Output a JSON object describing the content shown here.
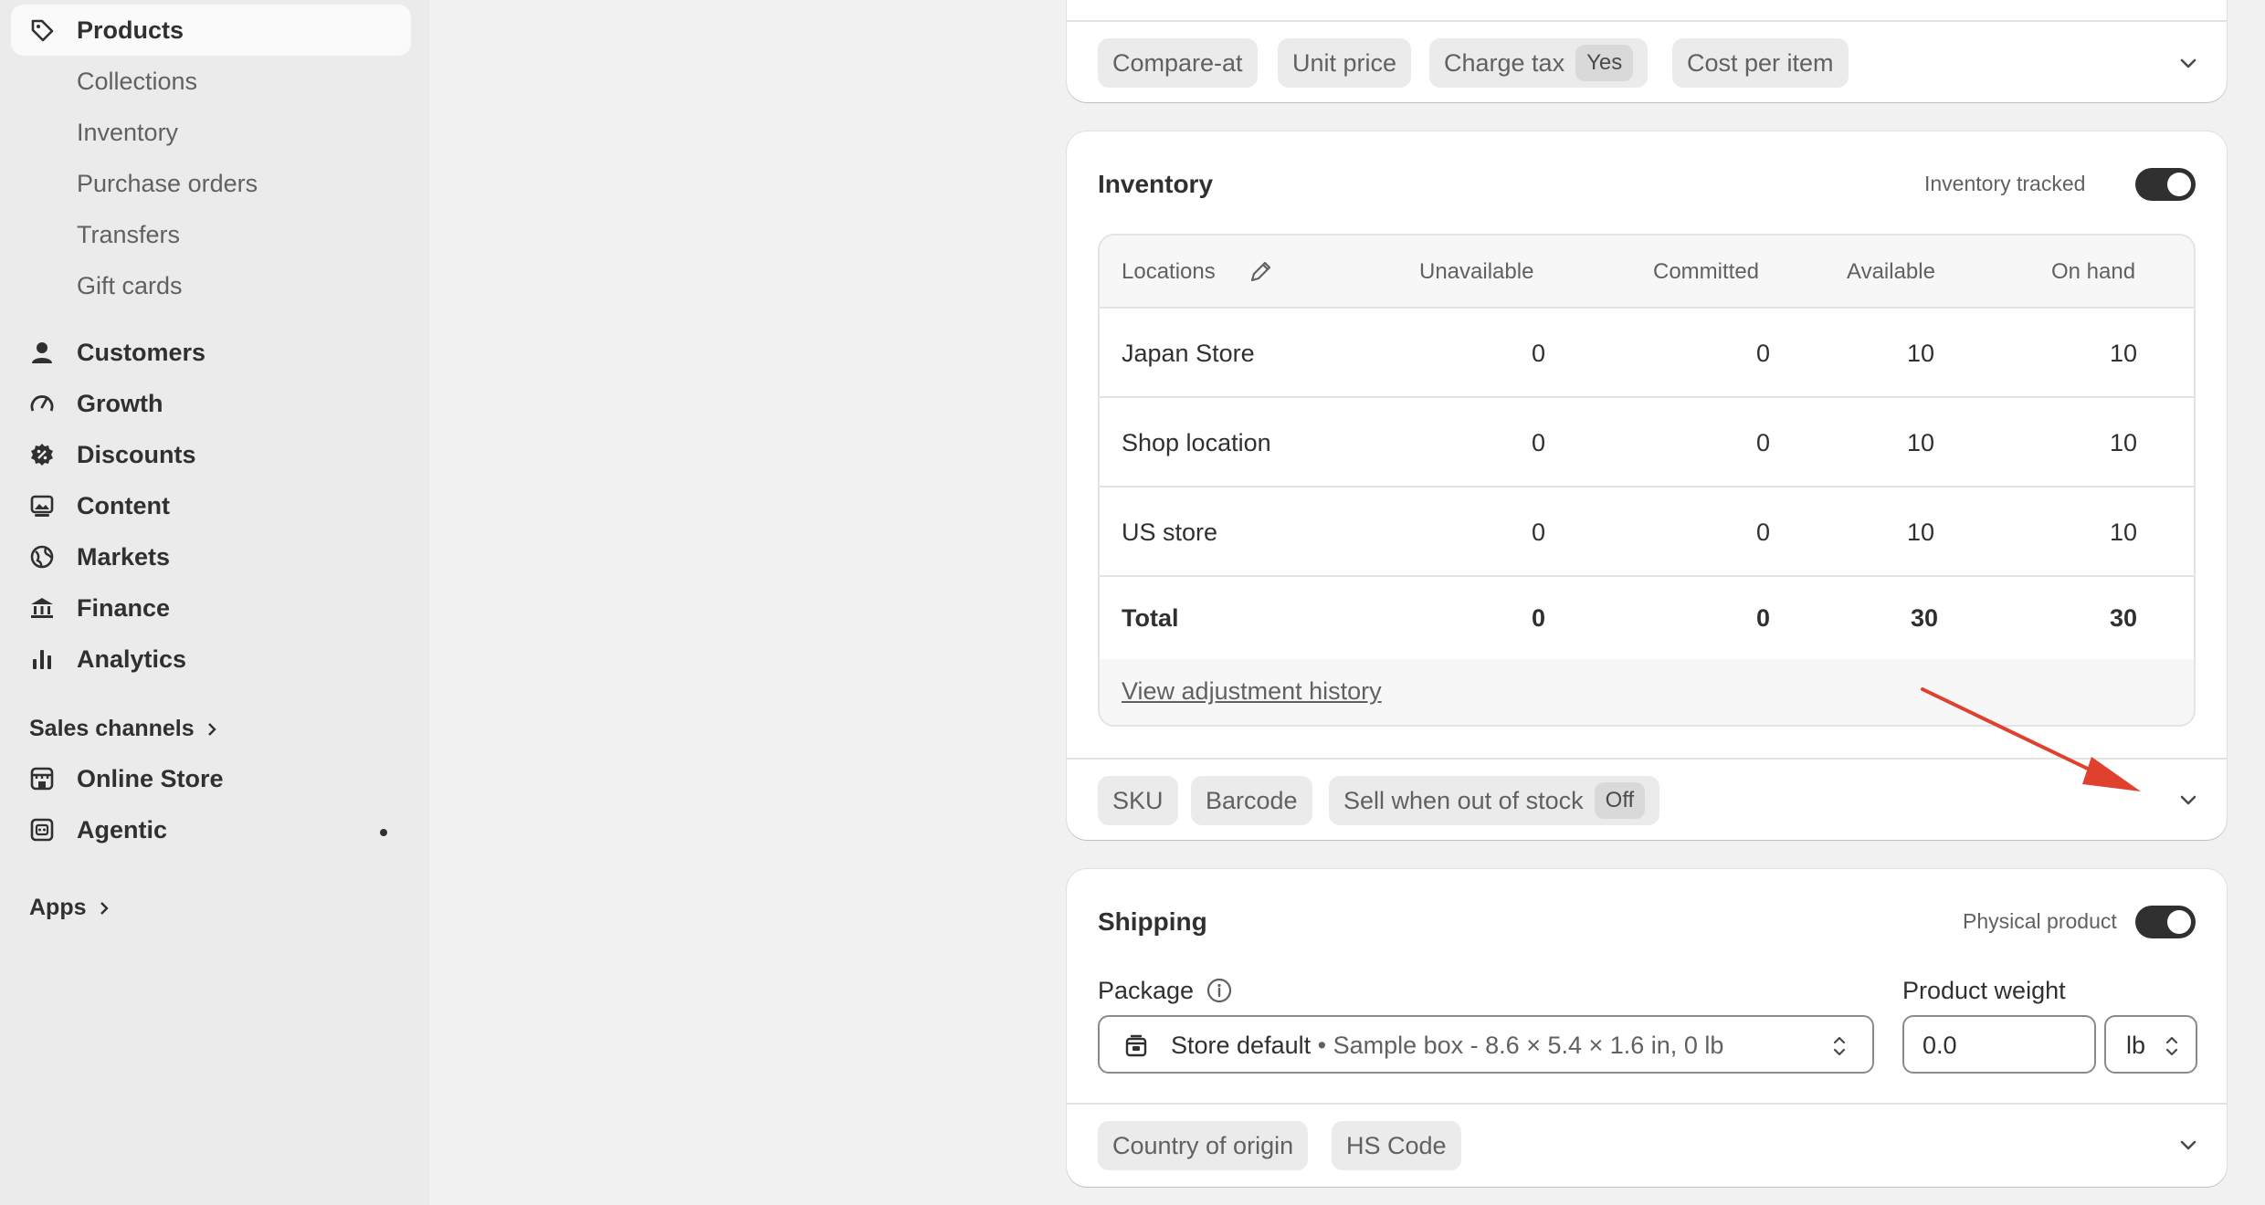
{
  "sidebar": {
    "products": "Products",
    "sub_items": [
      "Collections",
      "Inventory",
      "Purchase orders",
      "Transfers",
      "Gift cards"
    ],
    "main_items": [
      "Customers",
      "Growth",
      "Discounts",
      "Content",
      "Markets",
      "Finance",
      "Analytics"
    ],
    "sales_channels": "Sales channels",
    "channels": [
      "Online Store",
      "Agentic"
    ],
    "apps": "Apps"
  },
  "pricing": {
    "chips": [
      "Compare-at",
      "Unit price",
      "Charge tax",
      "Cost per item"
    ],
    "charge_tax_badge": "Yes"
  },
  "inventory": {
    "title": "Inventory",
    "tracked_label": "Inventory tracked",
    "tracked": true,
    "columns": [
      "Locations",
      "Unavailable",
      "Committed",
      "Available",
      "On hand"
    ],
    "rows": [
      {
        "location": "Japan Store",
        "unavailable": "0",
        "committed": "0",
        "available": "10",
        "on_hand": "10"
      },
      {
        "location": "Shop location",
        "unavailable": "0",
        "committed": "0",
        "available": "10",
        "on_hand": "10"
      },
      {
        "location": "US store",
        "unavailable": "0",
        "committed": "0",
        "available": "10",
        "on_hand": "10"
      }
    ],
    "total": {
      "label": "Total",
      "unavailable": "0",
      "committed": "0",
      "available": "30",
      "on_hand": "30"
    },
    "history_link": "View adjustment history",
    "chips": [
      "SKU",
      "Barcode",
      "Sell when out of stock"
    ],
    "sell_oos_badge": "Off"
  },
  "shipping": {
    "title": "Shipping",
    "physical_label": "Physical product",
    "physical": true,
    "package_label": "Package",
    "package_value": "Store default",
    "package_detail": "• Sample box - 8.6 × 5.4 × 1.6 in, 0 lb",
    "weight_label": "Product weight",
    "weight_value": "0.0",
    "weight_unit": "lb",
    "chips": [
      "Country of origin",
      "HS Code"
    ]
  },
  "colors": {
    "annotation_arrow": "#e0412f",
    "toggle_on": "#303030",
    "sidebar_bg": "#ebebeb"
  }
}
